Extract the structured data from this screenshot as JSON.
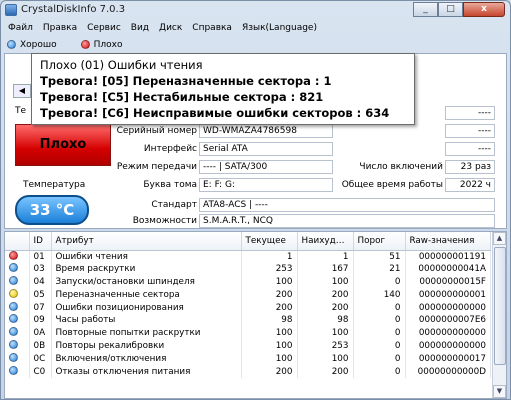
{
  "window": {
    "title": "CrystalDiskInfo 7.0.3",
    "min": "_",
    "max": "□",
    "close": "x"
  },
  "menu": [
    "Файл",
    "Правка",
    "Сервис",
    "Вид",
    "Диск",
    "Справка",
    "Язык(Language)"
  ],
  "status": [
    {
      "label": "Хорошо",
      "color": "blue"
    },
    {
      "label": "Плохо",
      "color": "red"
    }
  ],
  "tooltip": {
    "line0": "Плохо (01) Ошибки чтения",
    "line1": "Тревога! [05] Переназначенные сектора : 1",
    "line2": "Тревога! [C5] Нестабильные сектора : 821",
    "line3": "Тревога! [C6] Неисправимые ошибки секторов : 634"
  },
  "left": {
    "health_label_prefix": "Те",
    "health": "Плохо",
    "temp_label": "Температура",
    "temp": "33 °C"
  },
  "info": {
    "serial_label": "Серийный номер",
    "serial": "WD-WMAZA4786598",
    "interface_label": "Интерфейс",
    "interface": "Serial ATA",
    "transfer_label": "Режим передачи",
    "transfer": "---- | SATA/300",
    "letters_label": "Буква тома",
    "letters": "E: F: G:",
    "standard_label": "Стандарт",
    "standard": "ATA8-ACS | ----",
    "features_label": "Возможности",
    "features": "S.M.A.R.T., NCQ",
    "r0": "----",
    "r1": "----",
    "r2": "----",
    "power_count_label": "Число включений",
    "power_count": "23 раз",
    "hours_label": "Общее время работы",
    "hours": "2022 ч"
  },
  "table": {
    "headers": [
      "ID",
      "Атрибут",
      "Текущее",
      "Наихуд…",
      "Порог",
      "Raw-значения"
    ],
    "rows": [
      {
        "s": "red",
        "id": "01",
        "name": "Ошибки чтения",
        "cur": "1",
        "worst": "1",
        "thr": "51",
        "raw": "000000001191"
      },
      {
        "s": "blue",
        "id": "03",
        "name": "Время раскрутки",
        "cur": "253",
        "worst": "167",
        "thr": "21",
        "raw": "00000000041A"
      },
      {
        "s": "blue",
        "id": "04",
        "name": "Запуски/остановки шпинделя",
        "cur": "100",
        "worst": "100",
        "thr": "0",
        "raw": "00000000015F"
      },
      {
        "s": "yellow",
        "id": "05",
        "name": "Переназначенные сектора",
        "cur": "200",
        "worst": "200",
        "thr": "140",
        "raw": "000000000001"
      },
      {
        "s": "blue",
        "id": "07",
        "name": "Ошибки позиционирования",
        "cur": "200",
        "worst": "200",
        "thr": "0",
        "raw": "000000000000"
      },
      {
        "s": "blue",
        "id": "09",
        "name": "Часы работы",
        "cur": "98",
        "worst": "98",
        "thr": "0",
        "raw": "0000000007E6"
      },
      {
        "s": "blue",
        "id": "0A",
        "name": "Повторные попытки раскрутки",
        "cur": "100",
        "worst": "100",
        "thr": "0",
        "raw": "000000000000"
      },
      {
        "s": "blue",
        "id": "0B",
        "name": "Повторы рекалибровки",
        "cur": "100",
        "worst": "253",
        "thr": "0",
        "raw": "000000000000"
      },
      {
        "s": "blue",
        "id": "0C",
        "name": "Включения/отключения",
        "cur": "100",
        "worst": "100",
        "thr": "0",
        "raw": "000000000017"
      },
      {
        "s": "blue",
        "id": "C0",
        "name": "Отказы отключения питания",
        "cur": "200",
        "worst": "200",
        "thr": "0",
        "raw": "00000000000D"
      }
    ]
  }
}
